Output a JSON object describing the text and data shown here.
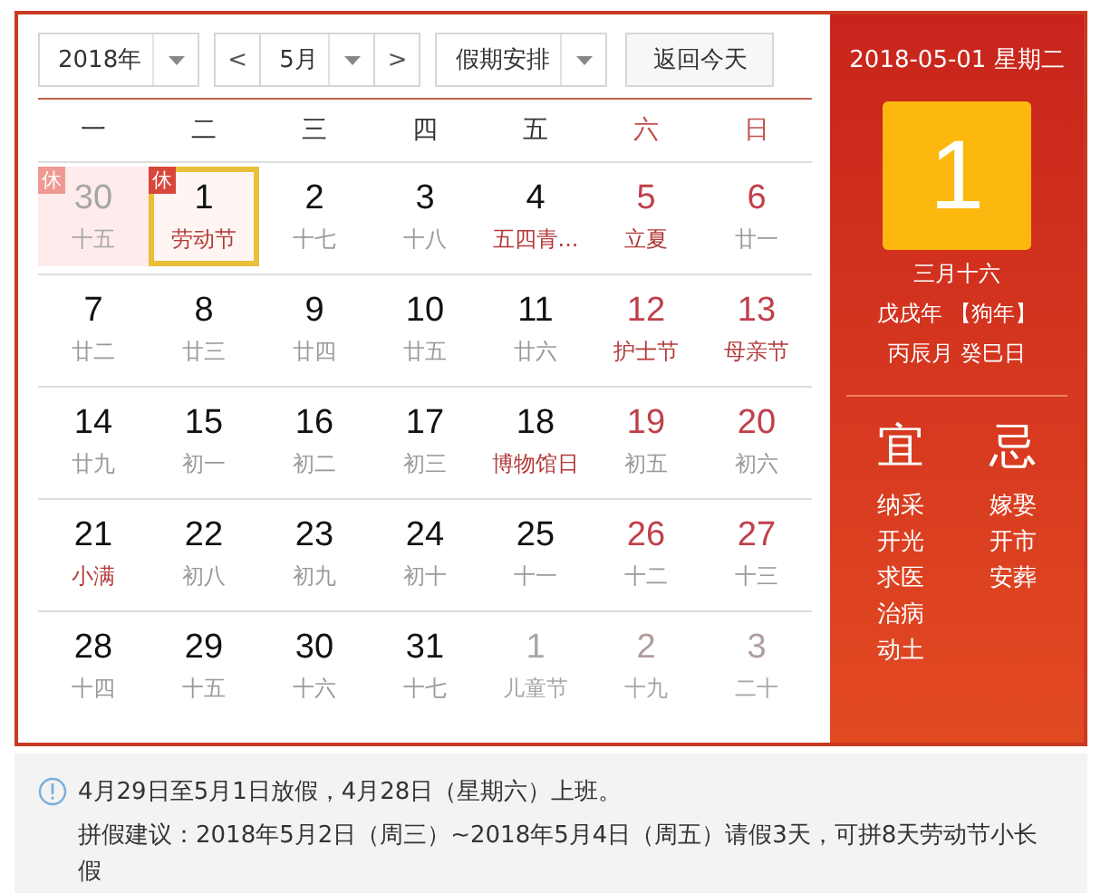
{
  "toolbar": {
    "year": "2018年",
    "month": "5月",
    "prev": "<",
    "next": ">",
    "holiday_select": "假期安排",
    "today_button": "返回今天"
  },
  "weekdays": [
    {
      "label": "一",
      "weekend": false
    },
    {
      "label": "二",
      "weekend": false
    },
    {
      "label": "三",
      "weekend": false
    },
    {
      "label": "四",
      "weekend": false
    },
    {
      "label": "五",
      "weekend": false
    },
    {
      "label": "六",
      "weekend": true
    },
    {
      "label": "日",
      "weekend": true
    }
  ],
  "weeks": [
    [
      {
        "day": "30",
        "lunar": "十五",
        "other_month": true,
        "weekend": false,
        "festival": false,
        "badge": "休",
        "selected": false
      },
      {
        "day": "1",
        "lunar": "劳动节",
        "other_month": false,
        "weekend": false,
        "festival": true,
        "badge": "休",
        "selected": true
      },
      {
        "day": "2",
        "lunar": "十七",
        "other_month": false,
        "weekend": false,
        "festival": false,
        "selected": false
      },
      {
        "day": "3",
        "lunar": "十八",
        "other_month": false,
        "weekend": false,
        "festival": false,
        "selected": false
      },
      {
        "day": "4",
        "lunar": "五四青...",
        "other_month": false,
        "weekend": false,
        "festival": true,
        "selected": false
      },
      {
        "day": "5",
        "lunar": "立夏",
        "other_month": false,
        "weekend": true,
        "festival": true,
        "selected": false
      },
      {
        "day": "6",
        "lunar": "廿一",
        "other_month": false,
        "weekend": true,
        "festival": false,
        "selected": false
      }
    ],
    [
      {
        "day": "7",
        "lunar": "廿二",
        "other_month": false,
        "weekend": false,
        "festival": false,
        "selected": false
      },
      {
        "day": "8",
        "lunar": "廿三",
        "other_month": false,
        "weekend": false,
        "festival": false,
        "selected": false
      },
      {
        "day": "9",
        "lunar": "廿四",
        "other_month": false,
        "weekend": false,
        "festival": false,
        "selected": false
      },
      {
        "day": "10",
        "lunar": "廿五",
        "other_month": false,
        "weekend": false,
        "festival": false,
        "selected": false
      },
      {
        "day": "11",
        "lunar": "廿六",
        "other_month": false,
        "weekend": false,
        "festival": false,
        "selected": false
      },
      {
        "day": "12",
        "lunar": "护士节",
        "other_month": false,
        "weekend": true,
        "festival": true,
        "selected": false
      },
      {
        "day": "13",
        "lunar": "母亲节",
        "other_month": false,
        "weekend": true,
        "festival": true,
        "selected": false
      }
    ],
    [
      {
        "day": "14",
        "lunar": "廿九",
        "other_month": false,
        "weekend": false,
        "festival": false,
        "selected": false
      },
      {
        "day": "15",
        "lunar": "初一",
        "other_month": false,
        "weekend": false,
        "festival": false,
        "selected": false
      },
      {
        "day": "16",
        "lunar": "初二",
        "other_month": false,
        "weekend": false,
        "festival": false,
        "selected": false
      },
      {
        "day": "17",
        "lunar": "初三",
        "other_month": false,
        "weekend": false,
        "festival": false,
        "selected": false
      },
      {
        "day": "18",
        "lunar": "博物馆日",
        "other_month": false,
        "weekend": false,
        "festival": true,
        "selected": false
      },
      {
        "day": "19",
        "lunar": "初五",
        "other_month": false,
        "weekend": true,
        "festival": false,
        "selected": false
      },
      {
        "day": "20",
        "lunar": "初六",
        "other_month": false,
        "weekend": true,
        "festival": false,
        "selected": false
      }
    ],
    [
      {
        "day": "21",
        "lunar": "小满",
        "other_month": false,
        "weekend": false,
        "festival": true,
        "selected": false
      },
      {
        "day": "22",
        "lunar": "初八",
        "other_month": false,
        "weekend": false,
        "festival": false,
        "selected": false
      },
      {
        "day": "23",
        "lunar": "初九",
        "other_month": false,
        "weekend": false,
        "festival": false,
        "selected": false
      },
      {
        "day": "24",
        "lunar": "初十",
        "other_month": false,
        "weekend": false,
        "festival": false,
        "selected": false
      },
      {
        "day": "25",
        "lunar": "十一",
        "other_month": false,
        "weekend": false,
        "festival": false,
        "selected": false
      },
      {
        "day": "26",
        "lunar": "十二",
        "other_month": false,
        "weekend": true,
        "festival": false,
        "selected": false
      },
      {
        "day": "27",
        "lunar": "十三",
        "other_month": false,
        "weekend": true,
        "festival": false,
        "selected": false
      }
    ],
    [
      {
        "day": "28",
        "lunar": "十四",
        "other_month": false,
        "weekend": false,
        "festival": false,
        "selected": false
      },
      {
        "day": "29",
        "lunar": "十五",
        "other_month": false,
        "weekend": false,
        "festival": false,
        "selected": false
      },
      {
        "day": "30",
        "lunar": "十六",
        "other_month": false,
        "weekend": false,
        "festival": false,
        "selected": false
      },
      {
        "day": "31",
        "lunar": "十七",
        "other_month": false,
        "weekend": false,
        "festival": false,
        "selected": false
      },
      {
        "day": "1",
        "lunar": "儿童节",
        "other_month": true,
        "weekend": false,
        "festival": true,
        "selected": false
      },
      {
        "day": "2",
        "lunar": "十九",
        "other_month": true,
        "weekend": true,
        "festival": false,
        "selected": false
      },
      {
        "day": "3",
        "lunar": "二十",
        "other_month": true,
        "weekend": true,
        "festival": false,
        "selected": false
      }
    ]
  ],
  "detail": {
    "date": "2018-05-01 星期二",
    "day": "1",
    "lunar_date": "三月十六",
    "year_ganzhi": "戊戌年 【狗年】",
    "month_day_ganzhi": "丙辰月 癸巳日",
    "good": {
      "title": "宜",
      "items": [
        "纳采",
        "开光",
        "求医",
        "治病",
        "动土"
      ]
    },
    "bad": {
      "title": "忌",
      "items": [
        "嫁娶",
        "开市",
        "安葬"
      ]
    }
  },
  "notice": {
    "lines": [
      "4月29日至5月1日放假，4月28日（星期六）上班。",
      "拼假建议：2018年5月2日（周三）~2018年5月4日（周五）请假3天，可拼8天劳动节小长假"
    ]
  }
}
